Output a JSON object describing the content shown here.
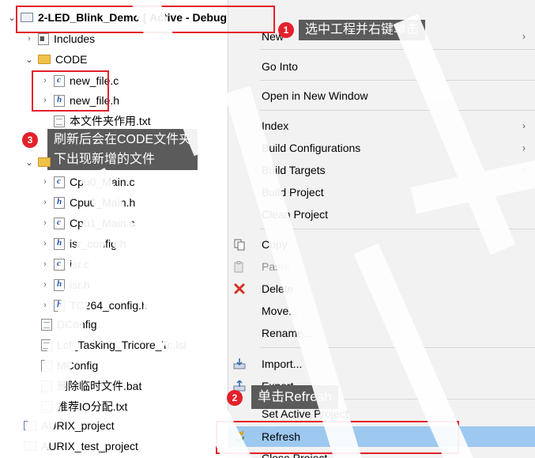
{
  "tree": {
    "project": "2-LED_Blink_Demo [ Active - Debug ]",
    "items": [
      {
        "label": "Includes",
        "icon": "includes-icon"
      },
      {
        "label": "CODE",
        "icon": "folder-icon"
      },
      {
        "label": "new_file.c",
        "icon": "c-file-icon"
      },
      {
        "label": "new_file.h",
        "icon": "h-file-icon"
      },
      {
        "label": "本文件夹作用.txt",
        "icon": "text-file-icon"
      },
      {
        "label": "Cpu0_Main.c",
        "icon": "c-file-icon"
      },
      {
        "label": "Cpu0_Main.h",
        "icon": "h-file-icon"
      },
      {
        "label": "Cpu1_Main.c",
        "icon": "c-file-icon"
      },
      {
        "label": "isr_config.h",
        "icon": "h-file-icon"
      },
      {
        "label": "isr.c",
        "icon": "c-file-icon"
      },
      {
        "label": "isr.h",
        "icon": "h-file-icon"
      },
      {
        "label": "TC264_config.h",
        "icon": "h-file-icon"
      },
      {
        "label": "DConfig",
        "icon": "text-file-icon"
      },
      {
        "label": "Lcf_Tasking_Tricore_Tc.lsl",
        "icon": "text-file-icon"
      },
      {
        "label": "MConfig",
        "icon": "text-file-icon"
      },
      {
        "label": "删除临时文件.bat",
        "icon": "batch-file-icon"
      },
      {
        "label": "推荐IO分配.txt",
        "icon": "text-file-icon"
      },
      {
        "label": "AURIX_project",
        "icon": "project-icon"
      },
      {
        "label": "AURIX_test_project",
        "icon": "project-icon"
      }
    ]
  },
  "menu": {
    "items": [
      {
        "label": "New",
        "submenu": true
      },
      {
        "label": "Go Into"
      },
      {
        "label": "Open in New Window"
      },
      {
        "label": "Index",
        "submenu": true
      },
      {
        "label": "Build Configurations",
        "submenu": true
      },
      {
        "label": "Build Targets",
        "submenu": true
      },
      {
        "label": "Build Project"
      },
      {
        "label": "Clean Project"
      },
      {
        "label": "Copy",
        "icon": "copy-icon"
      },
      {
        "label": "Paste",
        "icon": "paste-icon",
        "disabled": true
      },
      {
        "label": "Delete",
        "icon": "delete-icon"
      },
      {
        "label": "Move..."
      },
      {
        "label": "Rename..."
      },
      {
        "label": "Import...",
        "icon": "import-icon"
      },
      {
        "label": "Export...",
        "icon": "export-icon"
      },
      {
        "label": "Set Active Project"
      },
      {
        "label": "Refresh",
        "icon": "refresh-icon",
        "highlighted": true
      },
      {
        "label": "Close Project"
      }
    ],
    "submenu_arrow": "›"
  },
  "annotations": {
    "step1": {
      "number": "1",
      "text": "选中工程并右键单击"
    },
    "step2": {
      "number": "2",
      "text": "单击Refresh"
    },
    "step3": {
      "number": "3",
      "text_line1": "刷新后会在CODE文件夹",
      "text_line2": "下出现新增的文件"
    }
  },
  "colors": {
    "annotation_red": "#e3212b",
    "callout_bg": "#5b5b5b",
    "menu_bg": "#f2f2f2",
    "menu_highlight": "#9dc8f0"
  }
}
